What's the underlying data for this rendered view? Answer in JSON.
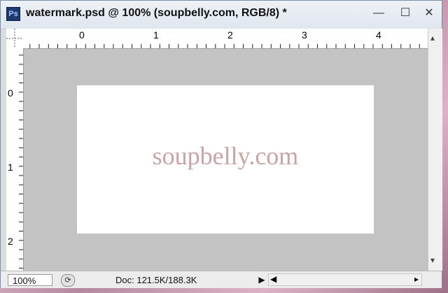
{
  "window": {
    "title": "watermark.psd @ 100% (soupbelly.com, RGB/8) *",
    "app_icon_text": "Ps",
    "buttons": {
      "minimize": "—",
      "maximize": "☐",
      "close": "✕"
    }
  },
  "ruler": {
    "top_labels": [
      "0",
      "1",
      "2",
      "3",
      "4"
    ],
    "left_labels": [
      "0",
      "1",
      "2"
    ]
  },
  "canvas": {
    "watermark_text": "soupbelly.com",
    "watermark_color": "#c9a3a6",
    "background_color": "#c3c3c3"
  },
  "status": {
    "zoom": "100%",
    "doc_info": "Doc: 121.5K/188.3K",
    "arrow_right": "▶",
    "scroll_left": "◀",
    "scroll_right": "▸"
  },
  "icons": {
    "rotate": "⟳",
    "scroll_up": "▴",
    "scroll_down": "▾"
  }
}
